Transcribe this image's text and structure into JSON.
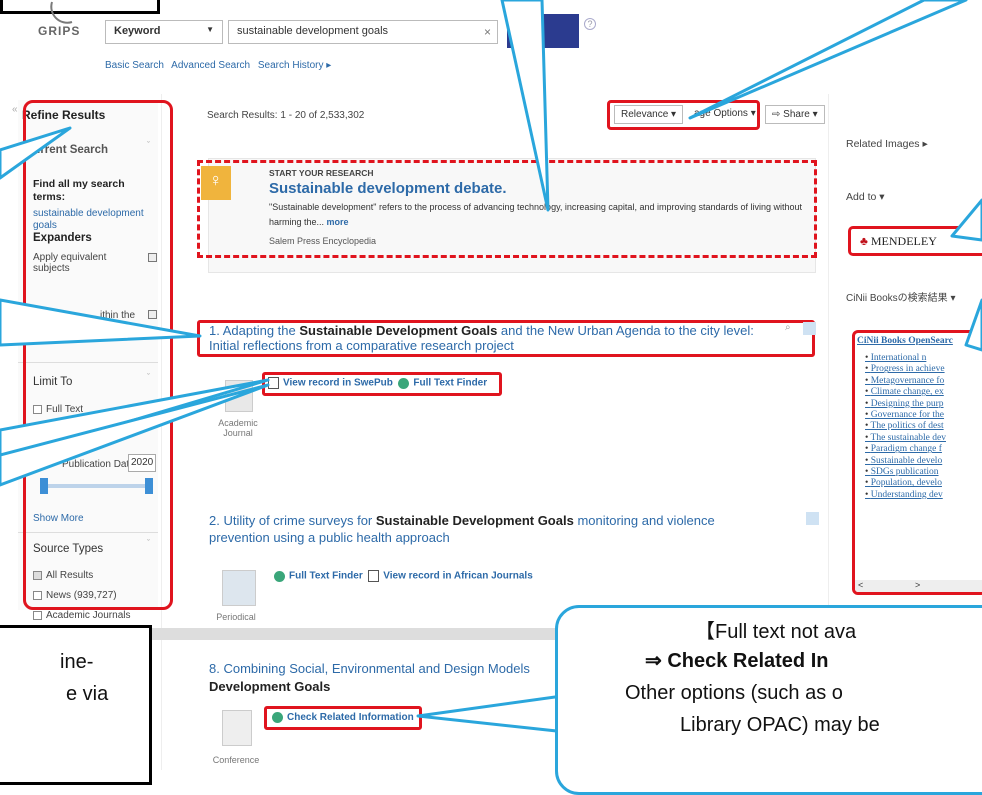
{
  "logo": {
    "text": "GRIPS"
  },
  "search": {
    "field": "Keyword",
    "query": "sustainable development goals",
    "clear": "×",
    "help": "?",
    "links": [
      "Basic Search",
      "Advanced Search",
      "Search History ▸"
    ]
  },
  "sidebar": {
    "refine": "Refine Results",
    "current": "Current Search",
    "find_all": "Find all my search terms:",
    "find_term": "sustainable development goals",
    "expanders": "Expanders",
    "apply_equiv": "Apply equivalent subjects",
    "within": "ithin the",
    "limit": "Limit To",
    "fulltext": "Full Text",
    "pubdate": "Publication Date",
    "pubyear": "2020",
    "show_more": "Show More",
    "source_types": "Source Types",
    "sources": [
      "All Results",
      "News (939,727)",
      "Academic Journals"
    ]
  },
  "results": {
    "count": "Search Results: 1 - 20 of 2,533,302",
    "relevance": "Relevance ▾",
    "page_options": "age Options ▾",
    "share": "Share ▾",
    "research_header": "START YOUR RESEARCH",
    "research_title": "Sustainable development debate.",
    "research_snippet": "\"Sustainable development\" refers to the process of advancing technology, increasing capital, and improving standards of living without harming the...",
    "research_more": "more",
    "research_source": "Salem Press Encyclopedia",
    "r1_title_pre": "1. Adapting the ",
    "r1_title_bold": "Sustainable Development Goals",
    "r1_title_post": " and the New Urban Agenda to the city level: Initial reflections from a comparative research project",
    "r1_link1": "View record in SwePub",
    "r1_link2": "Full Text Finder",
    "r1_type": "Academic Journal",
    "r2_title_pre": "2. Utility of crime surveys for ",
    "r2_title_bold": "Sustainable Development Goals",
    "r2_title_post": " monitoring and violence prevention using a public health approach",
    "r2_link1": "Full Text Finder",
    "r2_link2": "View record in African Journals",
    "r2_type": "Periodical",
    "r8_title_pre": "8. Combining Social, Environmental and Design Models",
    "r8_title_bold": "Development Goals",
    "r8_link": "Check Related Information",
    "r8_type": "Conference"
  },
  "right": {
    "related_images": "Related Images ▸",
    "add_to": "Add to ▾",
    "mendeley": "MENDELEY",
    "cinii_label": "CiNii Booksの検索結果 ▾",
    "cinii_head": "CiNii Books OpenSearc",
    "cinii_items": [
      "International n",
      "Progress in achieve",
      "Metagovernance fo",
      "Climate change, ex",
      "Designing the purp",
      "Governance for the",
      "The politics of dest",
      "The sustainable dev",
      "Paradigm change f",
      "Sustainable develo",
      "SDGs publication",
      "Population, develo",
      "Understanding dev"
    ],
    "scroll_left": "<",
    "scroll_right": ">"
  },
  "callouts": {
    "bottom_right_l1": "【Full text not ava",
    "bottom_right_l2": "⇒ Check Related In",
    "bottom_right_l3": "Other options (such as o",
    "bottom_right_l4": "Library OPAC) may be",
    "bottom_left_l1": "ine-",
    "bottom_left_l2": "e via"
  },
  "colors": {
    "red": "#e0141e",
    "cyan": "#2aa6dc",
    "link": "#2d6aa8"
  }
}
